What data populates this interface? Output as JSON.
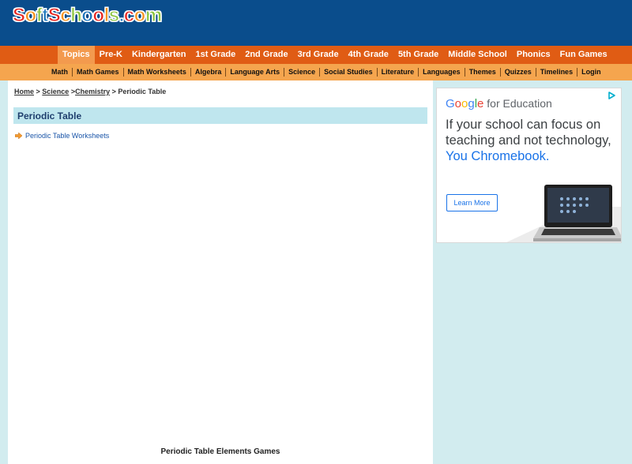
{
  "logo": {
    "letters": [
      "S",
      "o",
      "f",
      "t",
      "S",
      "c",
      "h",
      "o",
      "o",
      "l",
      "s",
      ".",
      "c",
      "o",
      "m"
    ],
    "colors": [
      "#e8251f",
      "#f7931e",
      "#8bc53f",
      "#1b75bb",
      "#e8251f",
      "#f7931e",
      "#8bc53f",
      "#1b75bb",
      "#e8251f",
      "#f7931e",
      "#8bc53f",
      "#1b75bb",
      "#e8251f",
      "#f7931e",
      "#8bc53f"
    ]
  },
  "nav_primary": [
    {
      "label": "Topics",
      "active": true
    },
    {
      "label": "Pre-K"
    },
    {
      "label": "Kindergarten"
    },
    {
      "label": "1st Grade"
    },
    {
      "label": "2nd Grade"
    },
    {
      "label": "3rd Grade"
    },
    {
      "label": "4th Grade"
    },
    {
      "label": "5th Grade"
    },
    {
      "label": "Middle School"
    },
    {
      "label": "Phonics"
    },
    {
      "label": "Fun Games"
    }
  ],
  "nav_secondary": [
    "Math",
    "Math Games",
    "Math Worksheets",
    "Algebra",
    "Language Arts",
    "Science",
    "Social Studies",
    "Literature",
    "Languages",
    "Themes",
    "Quizzes",
    "Timelines",
    "Login"
  ],
  "breadcrumb": {
    "home": "Home",
    "sep1": " > ",
    "science": "Science",
    "sep2": " >",
    "chemistry": "Chemistry",
    "current": " > Periodic Table"
  },
  "page_title": "Periodic Table",
  "links": [
    {
      "label": "Periodic Table Worksheets"
    }
  ],
  "footer_heading": "Periodic Table Elements Games",
  "ad": {
    "brand": "Google",
    "brand_suffix": " for Education",
    "headline": "If your school can focus on teaching and not technology,",
    "headline_highlight": "You Chromebook.",
    "cta": "Learn More"
  },
  "colors": {
    "header_bg": "#0a4d8c",
    "nav_primary_bg": "#e05c14",
    "nav_secondary_bg": "#f5a54e",
    "page_bg": "#d2ecef",
    "title_bar_bg": "#bfe6ee",
    "link_color": "#1a55a8"
  }
}
